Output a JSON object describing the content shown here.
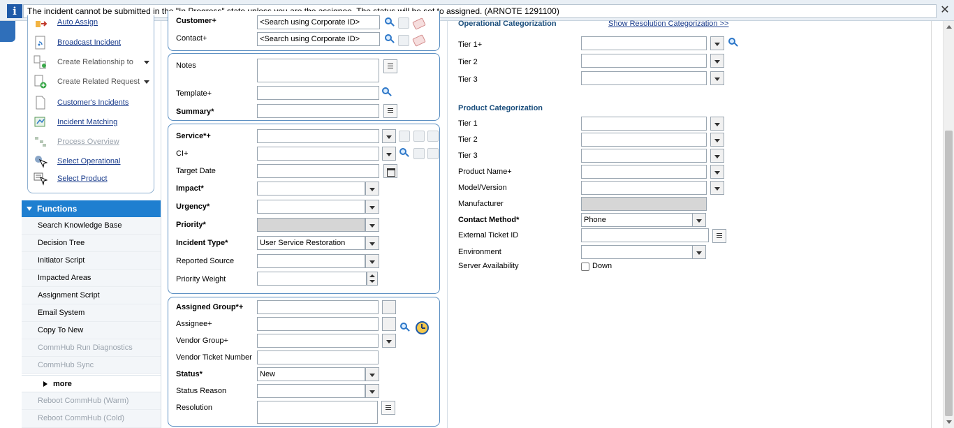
{
  "notice": {
    "icon": "info-icon",
    "glyph": "i",
    "message": "The incident cannot be submitted in the \"In Progress\" state unless you are the assignee. The status will be set to assigned. (ARNOTE 1291100)",
    "close_glyph": "✕"
  },
  "links": [
    {
      "label": "Auto Assign",
      "icon": "auto-assign-icon",
      "style": "link"
    },
    {
      "label": "Broadcast Incident",
      "icon": "broadcast-icon",
      "style": "link"
    },
    {
      "label": "Create Relationship to",
      "icon": "relationship-icon",
      "style": "grey",
      "dropdown": true
    },
    {
      "label": "Create Related Request",
      "icon": "related-request-icon",
      "style": "grey",
      "dropdown": true
    },
    {
      "label": "Customer's Incidents",
      "icon": "document-icon",
      "style": "link"
    },
    {
      "label": "Incident Matching",
      "icon": "incident-matching-icon",
      "style": "link"
    },
    {
      "label": "Process Overview",
      "icon": "process-overview-icon",
      "style": "dim"
    },
    {
      "label": "Select Operational",
      "icon": "select-operational-icon",
      "style": "link"
    },
    {
      "label": "Select Product",
      "icon": "select-product-icon",
      "style": "link"
    }
  ],
  "functions": {
    "title": "Functions",
    "items": [
      {
        "label": "Search Knowledge Base",
        "enabled": true
      },
      {
        "label": "Decision Tree",
        "enabled": true
      },
      {
        "label": "Initiator Script",
        "enabled": true
      },
      {
        "label": "Impacted Areas",
        "enabled": true
      },
      {
        "label": "Assignment Script",
        "enabled": true
      },
      {
        "label": "Email System",
        "enabled": true
      },
      {
        "label": "Copy To New",
        "enabled": true
      },
      {
        "label": "CommHub Run Diagnostics",
        "enabled": false
      },
      {
        "label": "CommHub Sync",
        "enabled": false
      }
    ],
    "more_label": "more",
    "extra_items": [
      {
        "label": "Reboot CommHub (Warm)",
        "enabled": false
      },
      {
        "label": "Reboot CommHub (Cold)",
        "enabled": false
      }
    ]
  },
  "customer_panel": {
    "customer_label": "Customer+",
    "customer_value": "<Search using Corporate ID>",
    "contact_label": "Contact+",
    "contact_value": "<Search using Corporate ID>"
  },
  "notes_panel": {
    "notes_label": "Notes",
    "template_label": "Template+",
    "summary_label": "Summary*"
  },
  "service_panel": {
    "service_label": "Service*+",
    "ci_label": "CI+",
    "target_date_label": "Target Date",
    "impact_label": "Impact*",
    "urgency_label": "Urgency*",
    "priority_label": "Priority*",
    "incident_type_label": "Incident Type*",
    "incident_type_value": "User Service Restoration",
    "reported_source_label": "Reported Source",
    "priority_weight_label": "Priority Weight"
  },
  "assignment_panel": {
    "assigned_group_label": "Assigned Group*+",
    "assignee_label": "Assignee+",
    "vendor_group_label": "Vendor Group+",
    "vendor_ticket_label": "Vendor Ticket Number",
    "status_label": "Status*",
    "status_value": "New",
    "status_reason_label": "Status Reason",
    "resolution_label": "Resolution"
  },
  "operational": {
    "title": "Operational Categorization",
    "show_resolution_link": "Show Resolution Categorization >>",
    "tier1_label": "Tier 1+",
    "tier2_label": "Tier 2",
    "tier3_label": "Tier 3"
  },
  "product": {
    "title": "Product Categorization",
    "tier1_label": "Tier 1",
    "tier2_label": "Tier 2",
    "tier3_label": "Tier 3",
    "product_name_label": "Product Name+",
    "model_version_label": "Model/Version",
    "manufacturer_label": "Manufacturer",
    "contact_method_label": "Contact Method*",
    "contact_method_value": "Phone",
    "external_ticket_label": "External Ticket ID",
    "environment_label": "Environment",
    "server_availability_label": "Server Availability",
    "down_label": "Down",
    "down_checked": false
  },
  "colors": {
    "functions_header": "#1f7fd0",
    "panel_border": "#5b8fc2",
    "section_title": "#1c4f7d",
    "link": "#1a3c8c",
    "info_icon": "#1f5aa8"
  }
}
